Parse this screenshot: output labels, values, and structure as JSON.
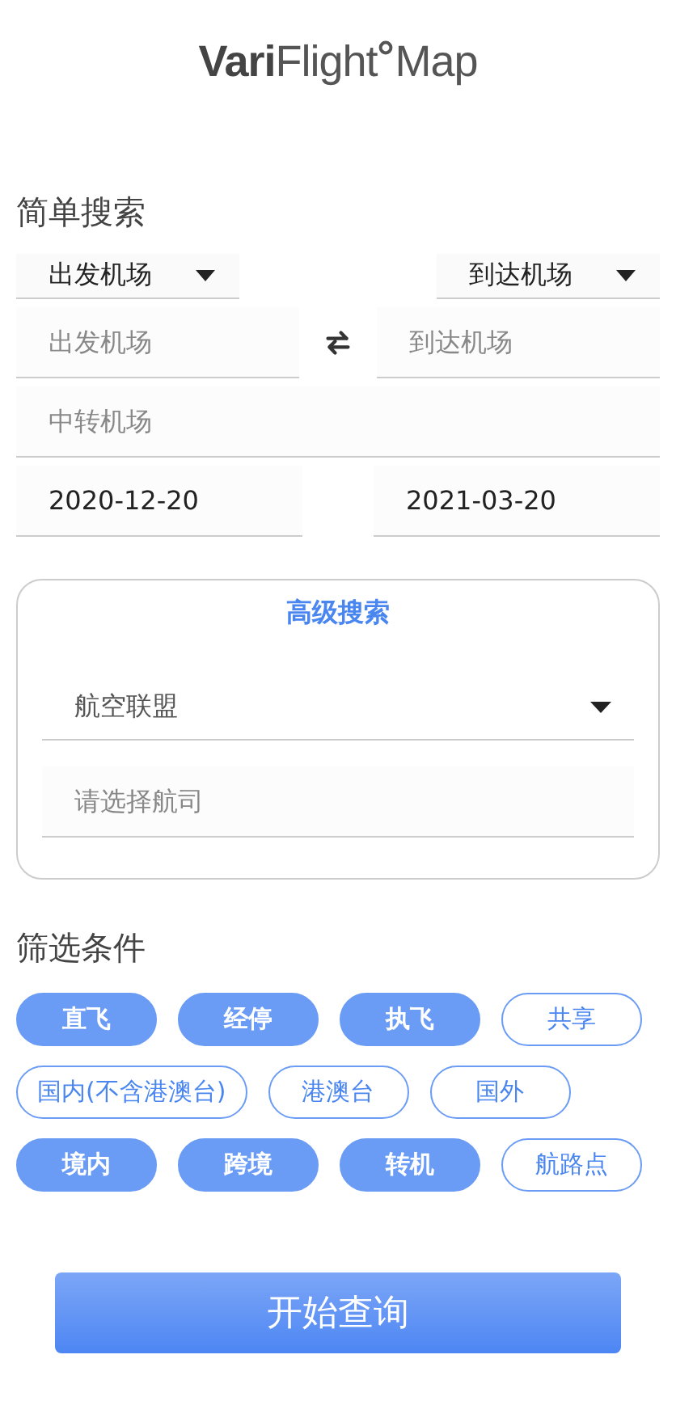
{
  "logo": {
    "bold": "Vari",
    "light": "Flight",
    "suffix": "Map"
  },
  "simple_search": {
    "title": "简单搜索",
    "selects": [
      {
        "value": "出发机场"
      },
      {
        "value": "到达机场"
      }
    ],
    "departure": {
      "placeholder": "出发机场"
    },
    "arrival": {
      "placeholder": "到达机场"
    },
    "transfer": {
      "placeholder": "中转机场"
    },
    "start_date": {
      "value": "2020-12-20"
    },
    "end_date": {
      "value": "2021-03-20"
    }
  },
  "advanced_search": {
    "title": "高级搜索",
    "alliance": {
      "placeholder": "航空联盟"
    },
    "airline": {
      "placeholder": "请选择航司"
    }
  },
  "filters": {
    "title": "筛选条件",
    "rows": [
      {
        "chips": [
          {
            "label": "直飞",
            "selected": true
          },
          {
            "label": "经停",
            "selected": true
          },
          {
            "label": "执飞",
            "selected": true
          },
          {
            "label": "共享",
            "selected": false
          }
        ]
      },
      {
        "chips": [
          {
            "label": "国内(不含港澳台)",
            "selected": false
          },
          {
            "label": "港澳台",
            "selected": false
          },
          {
            "label": "国外",
            "selected": false
          }
        ]
      },
      {
        "chips": [
          {
            "label": "境内",
            "selected": true
          },
          {
            "label": "跨境",
            "selected": true
          },
          {
            "label": "转机",
            "selected": true
          },
          {
            "label": "航路点",
            "selected": false
          }
        ]
      }
    ]
  },
  "submit": {
    "label": "开始查询"
  }
}
